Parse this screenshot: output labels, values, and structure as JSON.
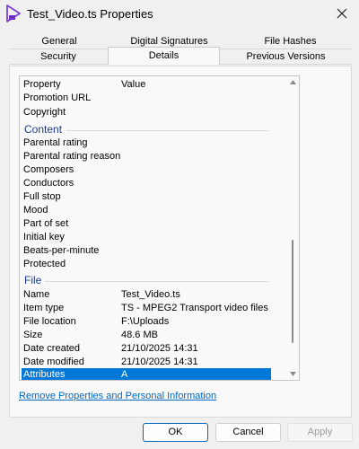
{
  "window": {
    "title": "Test_Video.ts Properties"
  },
  "tabs": {
    "back_row": [
      "General",
      "Digital Signatures",
      "File Hashes"
    ],
    "front_row": [
      "Security",
      "Details",
      "Previous Versions"
    ],
    "active": "Details"
  },
  "details": {
    "header": {
      "property": "Property",
      "value": "Value"
    },
    "rows_top": [
      {
        "property": "Promotion URL",
        "value": ""
      },
      {
        "property": "Copyright",
        "value": ""
      }
    ],
    "content_group": "Content",
    "content_rows": [
      "Parental rating",
      "Parental rating reason",
      "Composers",
      "Conductors",
      "Full stop",
      "Mood",
      "Part of set",
      "Initial key",
      "Beats-per-minute",
      "Protected"
    ],
    "file_group": "File",
    "file_rows": [
      {
        "property": "Name",
        "value": "Test_Video.ts"
      },
      {
        "property": "Item type",
        "value": "TS - MPEG2 Transport video files"
      },
      {
        "property": "File location",
        "value": "F:\\Uploads"
      },
      {
        "property": "Size",
        "value": "48.6 MB"
      },
      {
        "property": "Date created",
        "value": "21/10/2025 14:31"
      },
      {
        "property": "Date modified",
        "value": "21/10/2025 14:31"
      },
      {
        "property": "Attributes",
        "value": "A"
      }
    ],
    "selected_row": "Attributes"
  },
  "links": {
    "remove_properties": "Remove Properties and Personal Information"
  },
  "buttons": {
    "ok": "OK",
    "cancel": "Cancel",
    "apply": "Apply"
  },
  "colors": {
    "selection": "#0078d7",
    "group_header": "#1e3c8c",
    "link": "#0067c0"
  },
  "icons": {
    "app": "video-file-icon",
    "close": "close-icon"
  }
}
